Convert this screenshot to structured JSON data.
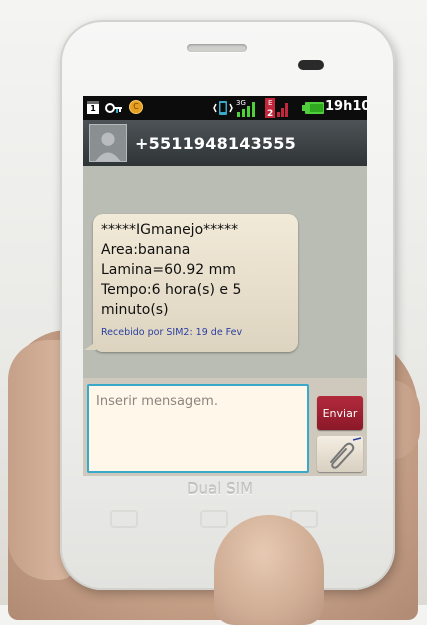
{
  "status_bar": {
    "calendar_day": "1",
    "coin_label": "C",
    "network_3g": "3G",
    "network_e": "E",
    "sim2_badge": "2",
    "time": "19h10"
  },
  "header": {
    "contact_number": "+5511948143555"
  },
  "message": {
    "body": "*****IGmanejo*****\nArea:banana\nLamina=60.92 mm\nTempo:6 hora(s) e 5\nminuto(s)",
    "meta": "Recebido por SIM2: 19 de Fev"
  },
  "composer": {
    "placeholder": "Inserir mensagem.",
    "send_label": "Enviar"
  },
  "device": {
    "brand_text": "Dual SIM"
  },
  "colors": {
    "accent_input_border": "#3aa8c9",
    "send_button": "#9a1f31",
    "status_bar": "#0c0c0c",
    "bubble": "#eee5d2",
    "meta_text": "#2a3fa0"
  },
  "icons": [
    "calendar-icon",
    "key-icon",
    "coin-icon",
    "vibrate-icon",
    "signal-3g-icon",
    "signal-e-icon",
    "battery-icon",
    "avatar-icon",
    "paperclip-icon"
  ]
}
